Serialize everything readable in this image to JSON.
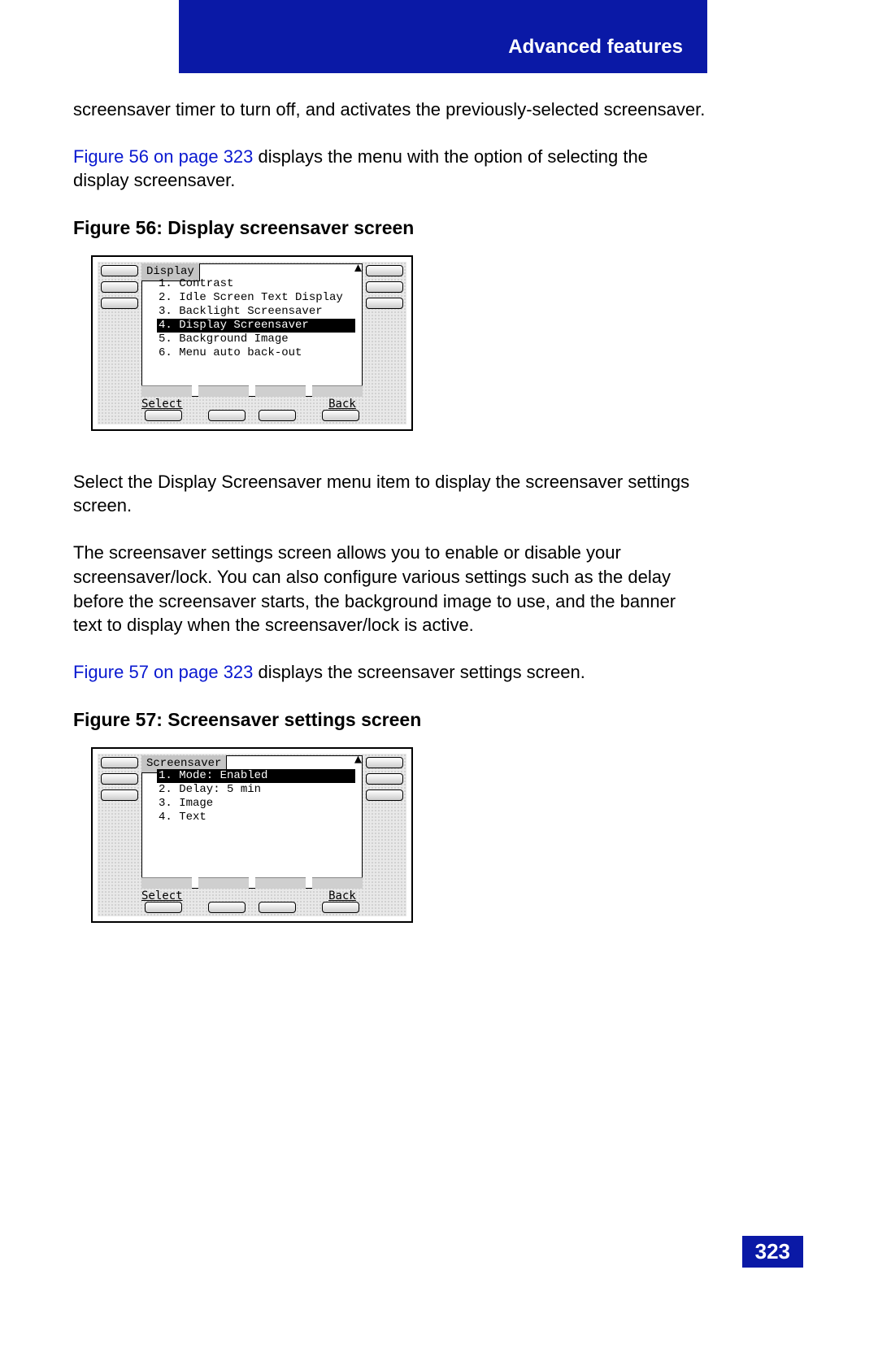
{
  "header": {
    "title": "Advanced features"
  },
  "page_number": "323",
  "paragraphs": {
    "p1": "screensaver timer to turn off, and activates the previously-selected screensaver.",
    "p2_link": "Figure 56 on page 323",
    "p2_rest": " displays the menu with the option of selecting the display screensaver.",
    "p3": "Select the Display Screensaver menu item to display the screensaver settings screen.",
    "p4": "The screensaver settings screen allows you to enable or disable your screensaver/lock. You can also configure various settings such as the delay before the screensaver starts, the background image to use, and the banner text to display when the screensaver/lock is active.",
    "p5_link": "Figure 57 on page 323",
    "p5_rest": " displays the screensaver settings screen."
  },
  "figures": {
    "f56": {
      "caption": "Figure 56: Display screensaver screen",
      "lcd_title": "Display",
      "items": [
        "1. Contrast",
        "2. Idle Screen Text Display",
        "3. Backlight Screensaver",
        "4. Display Screensaver",
        "5. Background Image",
        "6. Menu auto back-out"
      ],
      "selected_index": 3,
      "soft_left": "Select",
      "soft_right": "Back"
    },
    "f57": {
      "caption": "Figure 57: Screensaver settings screen",
      "lcd_title": "Screensaver",
      "items": [
        "1. Mode: Enabled",
        "2. Delay: 5 min",
        "3. Image",
        "4. Text"
      ],
      "selected_index": 0,
      "soft_left": "Select",
      "soft_right": "Back"
    }
  }
}
